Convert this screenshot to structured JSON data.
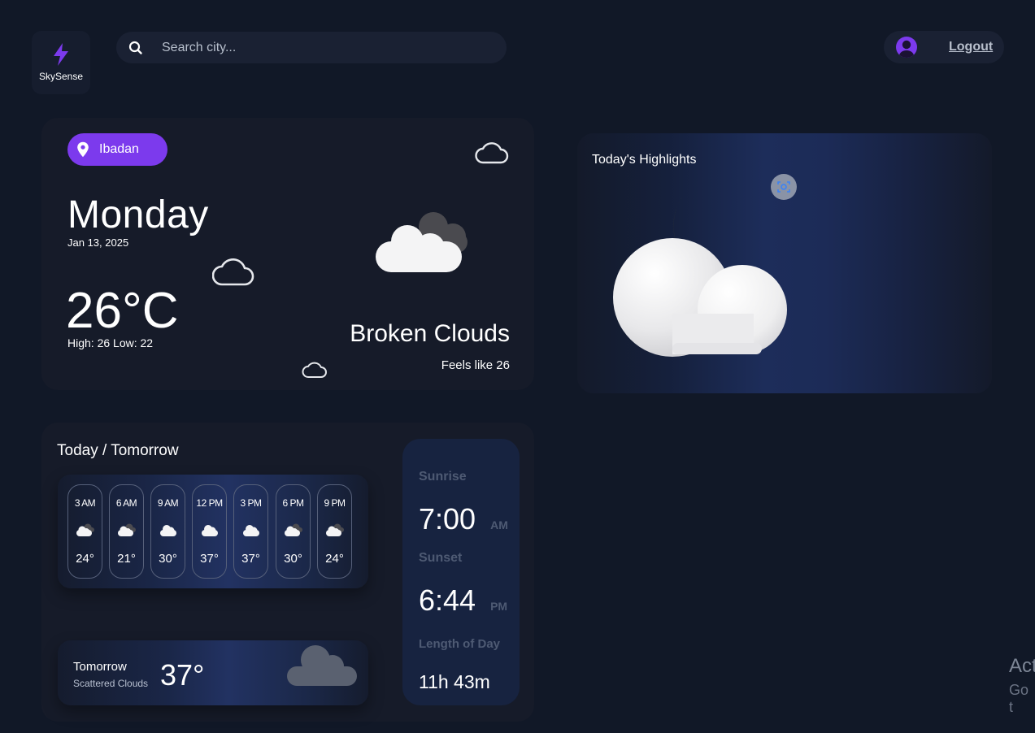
{
  "app": {
    "name": "SkySense",
    "logo_icon": "lightning-bolt-icon",
    "accent": "#7c3aed",
    "background": "#111827"
  },
  "search": {
    "placeholder": "Search city..."
  },
  "user": {
    "logout_label": "Logout"
  },
  "current": {
    "location": "Ibadan",
    "day": "Monday",
    "date": "Jan 13, 2025",
    "temperature": "26°C",
    "high_low": "High: 26 Low: 22",
    "condition": "Broken Clouds",
    "feels_like": "Feels like 26"
  },
  "highlights": {
    "title": "Today's Highlights",
    "icon": "moon-cloud-icon"
  },
  "forecast": {
    "title": "Today / Tomorrow",
    "hours": [
      {
        "time": "3 AM",
        "temp": "24°",
        "icon": "broken-clouds-icon"
      },
      {
        "time": "6 AM",
        "temp": "21°",
        "icon": "broken-clouds-icon"
      },
      {
        "time": "9 AM",
        "temp": "30°",
        "icon": "cloud-icon"
      },
      {
        "time": "12 PM",
        "temp": "37°",
        "icon": "cloud-icon"
      },
      {
        "time": "3 PM",
        "temp": "37°",
        "icon": "cloud-icon"
      },
      {
        "time": "6 PM",
        "temp": "30°",
        "icon": "broken-clouds-icon"
      },
      {
        "time": "9 PM",
        "temp": "24°",
        "icon": "broken-clouds-icon"
      }
    ],
    "tomorrow": {
      "label": "Tomorrow",
      "condition": "Scattered Clouds",
      "temp": "37°"
    }
  },
  "sun": {
    "sunrise_label": "Sunrise",
    "sunrise_time": "7:00",
    "sunrise_ampm": "AM",
    "sunset_label": "Sunset",
    "sunset_time": "6:44",
    "sunset_ampm": "PM",
    "length_label": "Length of Day",
    "length_value": "11h 43m"
  },
  "system_watermark": {
    "line1": "Act",
    "line2": "Go t"
  }
}
